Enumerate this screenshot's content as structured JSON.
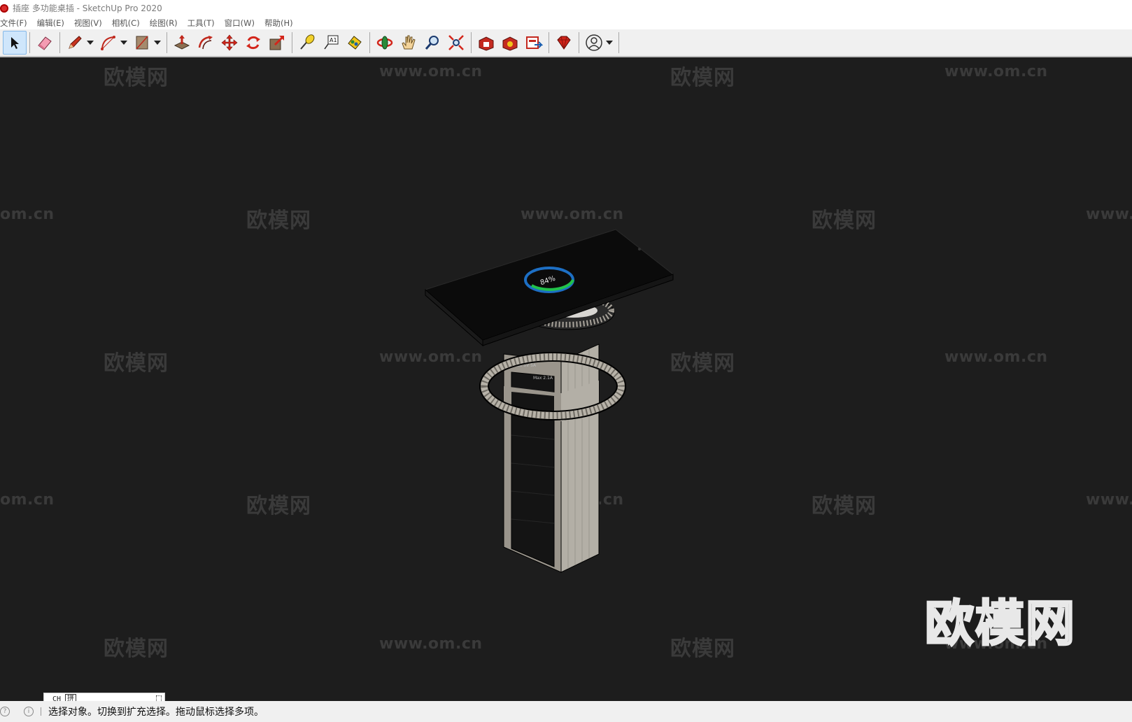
{
  "window": {
    "title": "插座 多功能桌插 - SketchUp Pro 2020"
  },
  "menu": [
    {
      "label": "文件(F)"
    },
    {
      "label": "编辑(E)"
    },
    {
      "label": "视图(V)"
    },
    {
      "label": "相机(C)"
    },
    {
      "label": "绘图(R)"
    },
    {
      "label": "工具(T)"
    },
    {
      "label": "窗口(W)"
    },
    {
      "label": "帮助(H)"
    }
  ],
  "toolbar": {
    "tools": [
      {
        "name": "select-tool",
        "icon": "arrow-cursor-icon",
        "active": true
      },
      {
        "name": "eraser-tool",
        "icon": "eraser-icon"
      },
      {
        "name": "line-tool",
        "icon": "pencil-icon",
        "dropdown": true
      },
      {
        "name": "arc-tool",
        "icon": "arc-icon",
        "dropdown": true
      },
      {
        "name": "shape-tool",
        "icon": "rectangle-icon",
        "dropdown": true
      },
      {
        "name": "push-pull-tool",
        "icon": "push-pull-icon"
      },
      {
        "name": "offset-tool",
        "icon": "offset-icon"
      },
      {
        "name": "move-tool",
        "icon": "move-icon"
      },
      {
        "name": "rotate-tool",
        "icon": "rotate-icon"
      },
      {
        "name": "scale-tool",
        "icon": "scale-icon"
      },
      {
        "name": "tape-measure-tool",
        "icon": "tape-measure-icon"
      },
      {
        "name": "text-tool",
        "icon": "text-icon"
      },
      {
        "name": "paint-bucket-tool",
        "icon": "paint-bucket-icon"
      },
      {
        "name": "orbit-tool",
        "icon": "orbit-icon"
      },
      {
        "name": "pan-tool",
        "icon": "hand-icon"
      },
      {
        "name": "zoom-tool",
        "icon": "magnifier-icon"
      },
      {
        "name": "zoom-extents-tool",
        "icon": "zoom-extents-icon"
      },
      {
        "name": "3d-warehouse-tool",
        "icon": "warehouse-icon"
      },
      {
        "name": "extension-warehouse-tool",
        "icon": "extension-icon"
      },
      {
        "name": "layout-tool",
        "icon": "layout-icon"
      },
      {
        "name": "ruby-console-tool",
        "icon": "ruby-icon"
      },
      {
        "name": "account-tool",
        "icon": "user-circle-icon",
        "dropdown": true
      }
    ]
  },
  "viewport": {
    "watermarks": [
      {
        "text": "欧模网"
      },
      {
        "text": "www.om.cn"
      },
      {
        "text": "欧模网"
      },
      {
        "text": "www.om.cn"
      },
      {
        "text": "om.cn"
      },
      {
        "text": "欧模网"
      },
      {
        "text": "www.om.cn"
      },
      {
        "text": "欧模网"
      },
      {
        "text": "www.om.cn"
      },
      {
        "text": "欧模网"
      },
      {
        "text": "www.om.cn"
      },
      {
        "text": "欧模网"
      },
      {
        "text": "www.om.cn"
      },
      {
        "text": "om.cn"
      },
      {
        "text": "欧模网"
      },
      {
        "text": "www.om.cn"
      },
      {
        "text": "欧模网"
      },
      {
        "text": "www.om.cn"
      },
      {
        "text": "欧模网"
      },
      {
        "text": "www.om.cn"
      },
      {
        "text": "欧模网"
      },
      {
        "text": "www.om.cn"
      }
    ],
    "logo": "欧模网",
    "phone_screen_text": "84%",
    "socket_label_1": "Max 5V 5A",
    "socket_label_2": "Max 2.1A",
    "colors": {
      "background": "#1d1d1d",
      "ring_green": "#22c24a",
      "ring_blue": "#1d6fc4",
      "column_face": "#a9a59c"
    }
  },
  "ime": {
    "mode": "CH",
    "pinyin": "拼"
  },
  "status": {
    "text": "选择对象。切换到扩充选择。拖动鼠标选择多项。"
  }
}
